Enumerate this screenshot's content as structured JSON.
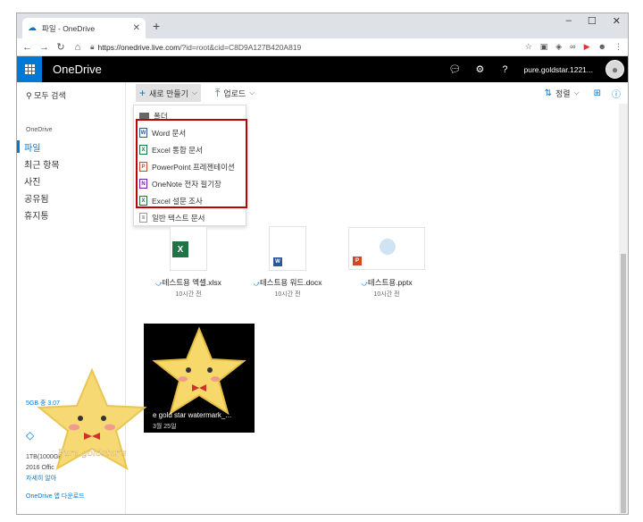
{
  "browser": {
    "tab_title": "파일 - OneDrive",
    "url_host": "https://onedrive.live.com",
    "url_path": "/?id=root&cid=C8D9A127B420A819"
  },
  "onedrive": {
    "brand": "OneDrive",
    "user": "pure.goldstar.1221...",
    "accent": "#0078d4"
  },
  "sidebar": {
    "search": "모두 검색",
    "section": "OneDrive",
    "items": [
      "파일",
      "최근 항목",
      "사진",
      "공유됨",
      "휴지통"
    ],
    "storage": "5GB 중 3.07",
    "promo_line1": "1TB(1000GB",
    "promo_line2": "2016 Offic",
    "promo_link": "자세히 알아",
    "download": "OneDrive 앱 다운로드"
  },
  "commands": {
    "new": "새로 만들기",
    "upload": "업로드",
    "sort": "정렬"
  },
  "new_menu": [
    "폴더",
    "Word 문서",
    "Excel 통합 문서",
    "PowerPoint 프레젠테이션",
    "OneNote 전자 필기장",
    "Excel 설문 조사",
    "일반 텍스트 문서"
  ],
  "files": [
    {
      "name": "테스트용 엑셀.xlsx",
      "time": "10시간 전"
    },
    {
      "name": "테스트용 워드.docx",
      "time": "10시간 전"
    },
    {
      "name": "테스트용.pptx",
      "time": "10시간 전"
    }
  ],
  "photo": {
    "name": "e gold star watermark_...",
    "date": "3월 25일"
  },
  "watermark": {
    "text1": "Pure goldstar's",
    "text2": "World ..."
  }
}
